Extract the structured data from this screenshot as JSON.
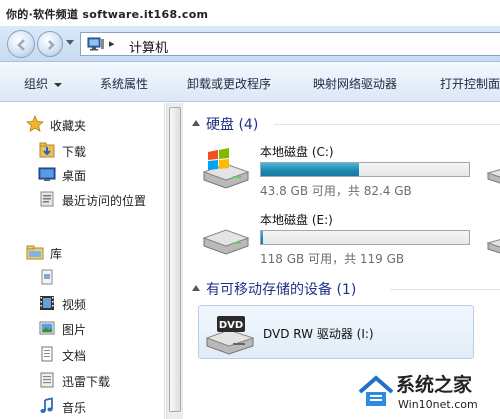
{
  "watermark_top": "你的·软件频道 software.it168.com",
  "address": {
    "crumb": "计算机",
    "separator": "▸"
  },
  "toolbar": {
    "organize": "组织",
    "system_properties": "系统属性",
    "uninstall": "卸载或更改程序",
    "map_drive": "映射网络驱动器",
    "control_panel": "打开控制面"
  },
  "nav": {
    "favorites": "收藏夹",
    "downloads": "下载",
    "desktop": "桌面",
    "recent": "最近访问的位置",
    "libraries": "库",
    "videos": "视频",
    "pictures": "图片",
    "documents": "文档",
    "thunder": "迅雷下载",
    "music": "音乐"
  },
  "groups": {
    "hdd": "硬盘 (4)",
    "removable": "有可移动存储的设备 (1)"
  },
  "drives": [
    {
      "name": "本地磁盘 (C:)",
      "free": "43.8 GB 可用，共 82.4 GB",
      "used_fraction": 0.47
    },
    {
      "name": "本地磁盘 (E:)",
      "free": "118 GB 可用，共 119 GB",
      "used_fraction": 0.01
    }
  ],
  "dvd": {
    "name": "DVD RW 驱动器 (I:)",
    "label": "DVD"
  },
  "watermark_bottom": {
    "brand": "系统之家",
    "url": "Win10net.com"
  },
  "colors": {
    "title_blue": "#1e3287",
    "bar_fill": "#1b86b0"
  }
}
